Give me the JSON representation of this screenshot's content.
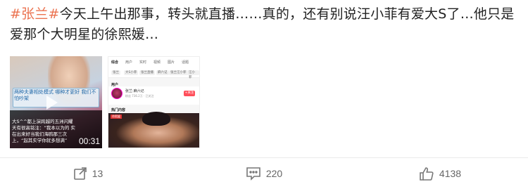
{
  "post": {
    "topic": "#张兰#",
    "text": "今天上午出那事，转头就直播……真的，还有别说汪小菲有爱大S了…他只是爱那个大明星的徐熙媛…"
  },
  "video": {
    "banner_text": "两种夫妻相处模式 哪种才更好 我们不怕吵架",
    "caption": "大S^^都上演跨越的五洲闪耀 天有很高铭注：“我本以为的 实在出来好当我们海鸥那三次 上，“起其实学你就多想满”",
    "duration": "00:31",
    "icon": "play-icon"
  },
  "screenshot": {
    "tabs": [
      "综合",
      "用户",
      "实时",
      "视频",
      "图片",
      "话题"
    ],
    "chips": [
      "张兰",
      "大S小菲",
      "张兰直播",
      "麻六记",
      "张兰汪小菲",
      "汪小菲"
    ],
    "section": "用户",
    "username": "张兰·麻六记",
    "user_meta": "粉丝 736.2万 · 已关注",
    "follow": "+关注",
    "label": "热门内容",
    "badge": "徐熙媛"
  },
  "actions": {
    "repost": {
      "icon": "share-icon",
      "count": "13"
    },
    "comment": {
      "icon": "comment-icon",
      "count": "220"
    },
    "like": {
      "icon": "thumbs-up-icon",
      "count": "4138"
    }
  },
  "colors": {
    "topic": "#eb7350",
    "text": "#222222",
    "action": "#666666"
  }
}
